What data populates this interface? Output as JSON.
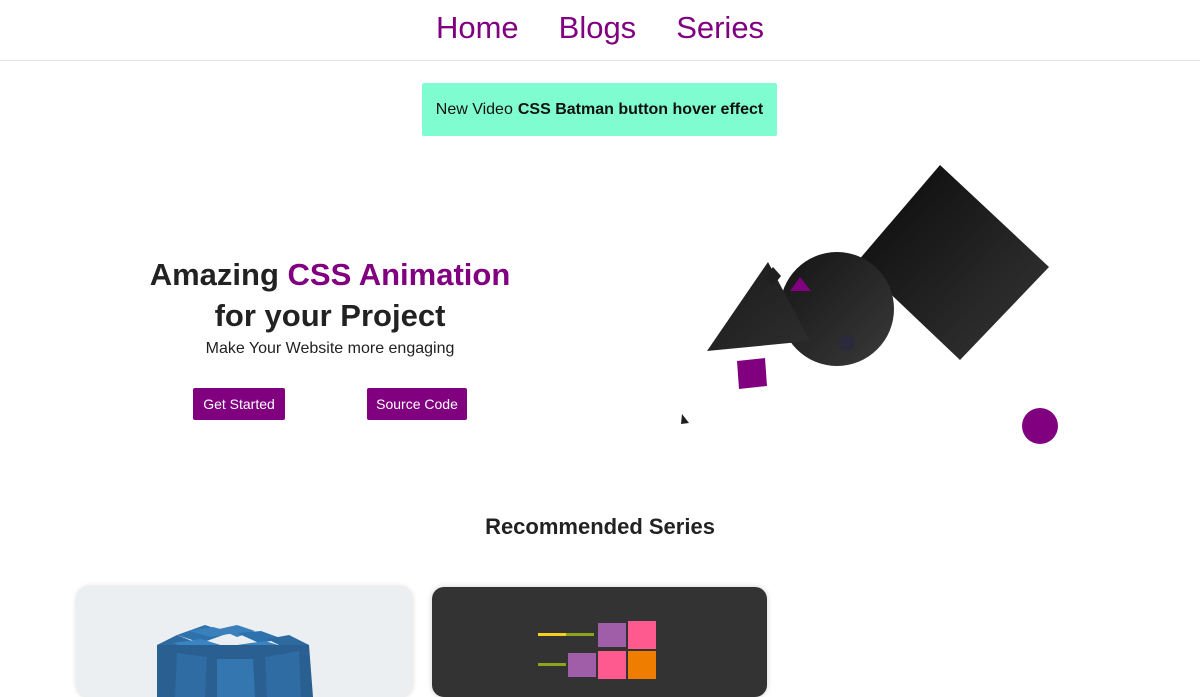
{
  "nav": {
    "items": [
      {
        "label": "Home"
      },
      {
        "label": "Blogs"
      },
      {
        "label": "Series"
      }
    ]
  },
  "banner": {
    "prefix": "New Video",
    "highlight": "CSS Batman button hover effect"
  },
  "hero": {
    "title_part1": "Amazing ",
    "title_accent": "CSS Animation",
    "title_part2": "for your Project",
    "subtitle": "Make Your Website more engaging",
    "primary_button": "Get Started",
    "secondary_button": "Source Code"
  },
  "recommended": {
    "heading": "Recommended Series"
  },
  "colors": {
    "brand": "#800080",
    "banner_bg": "#7ffcd0",
    "dark_shape": "#1e1e1e",
    "card_light": "#eceff1",
    "card_dark": "#333333"
  }
}
